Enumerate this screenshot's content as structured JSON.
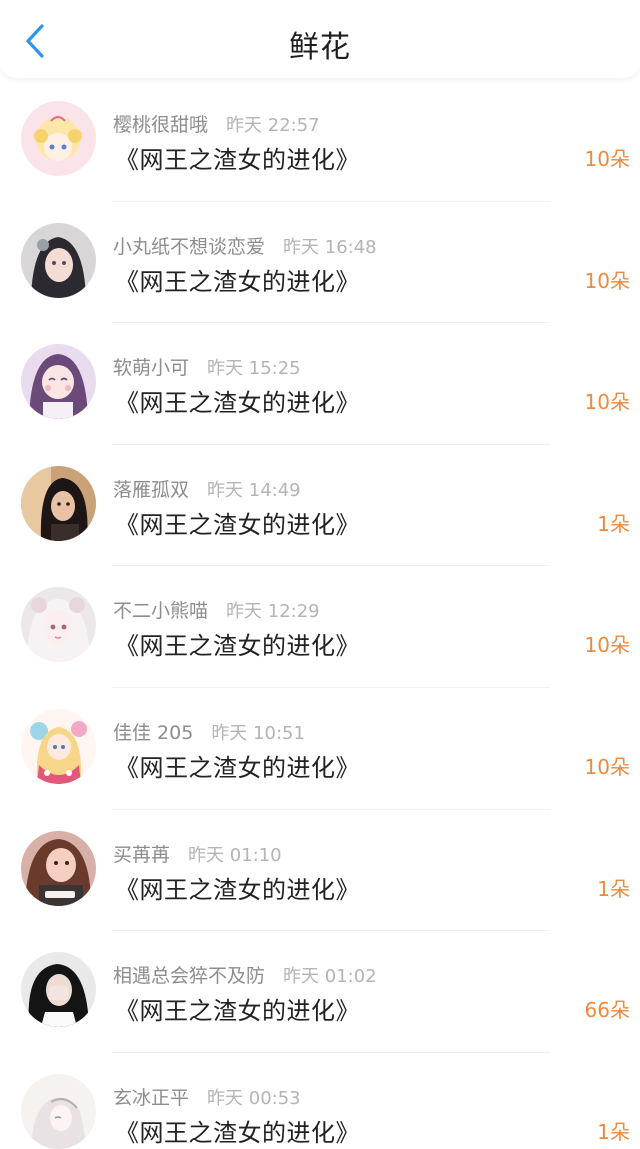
{
  "header": {
    "title": "鲜花",
    "back_icon": "chevron-left-icon",
    "accent_color": "#2b95e9"
  },
  "colors": {
    "count": "#f0893c",
    "username": "#8d8d8d",
    "time": "#b4b4b4"
  },
  "items": [
    {
      "user": "樱桃很甜哦",
      "time": "昨天 22:57",
      "book": "《网王之渣女的进化》",
      "count": "10朵"
    },
    {
      "user": "小丸纸不想谈恋爱",
      "time": "昨天 16:48",
      "book": "《网王之渣女的进化》",
      "count": "10朵"
    },
    {
      "user": "软萌小可",
      "time": "昨天 15:25",
      "book": "《网王之渣女的进化》",
      "count": "10朵"
    },
    {
      "user": "落雁孤双",
      "time": "昨天 14:49",
      "book": "《网王之渣女的进化》",
      "count": "1朵"
    },
    {
      "user": "不二小熊喵",
      "time": "昨天 12:29",
      "book": "《网王之渣女的进化》",
      "count": "10朵"
    },
    {
      "user": "佳佳 205",
      "time": "昨天 10:51",
      "book": "《网王之渣女的进化》",
      "count": "10朵"
    },
    {
      "user": "买苒苒",
      "time": "昨天 01:10",
      "book": "《网王之渣女的进化》",
      "count": "1朵"
    },
    {
      "user": "相遇总会猝不及防",
      "time": "昨天 01:02",
      "book": "《网王之渣女的进化》",
      "count": "66朵"
    },
    {
      "user": "玄冰正平",
      "time": "昨天 00:53",
      "book": "《网王之渣女的进化》",
      "count": "1朵"
    }
  ]
}
